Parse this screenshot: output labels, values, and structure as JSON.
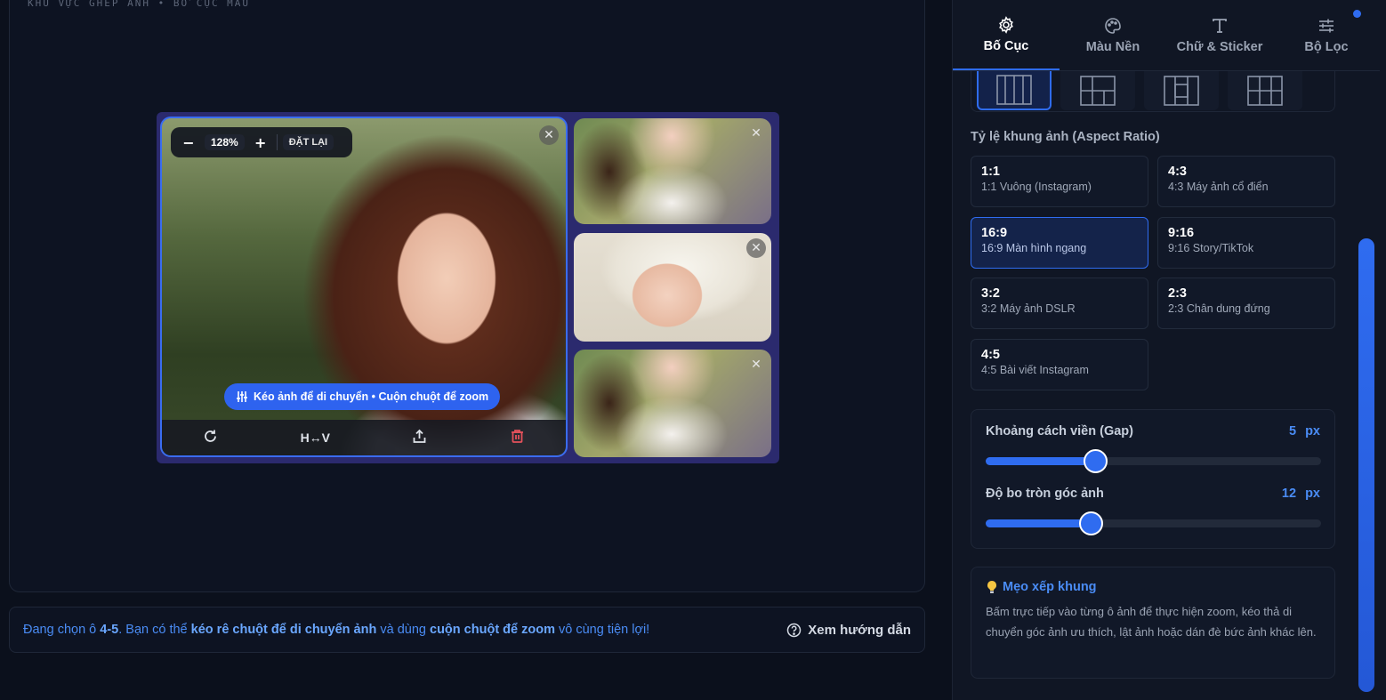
{
  "workspace": {
    "caption": "Khu vực ghép ảnh • Bố cục mẫu",
    "zoom": {
      "minus": "−",
      "value": "128%",
      "plus": "+",
      "reset": "ĐẶT LẠI"
    },
    "hint": "Kéo ảnh để di chuyển • Cuộn chuột để zoom",
    "toolbar": {
      "flip": "H↔V"
    },
    "close_glyph": "✕"
  },
  "status": {
    "prefix": "Đang chọn ô ",
    "cell": "4-5",
    "mid1": ". Bạn có thể ",
    "drag": "kéo rê chuột để di chuyển ảnh",
    "mid2": " và dùng ",
    "scroll": "cuộn chuột để zoom",
    "suffix": " vô cùng tiện lợi!",
    "guide": "Xem hướng dẫn"
  },
  "panel": {
    "tabs": [
      {
        "label": "Bố Cục",
        "icon": "gear-icon",
        "active": true
      },
      {
        "label": "Màu Nền",
        "icon": "palette-icon"
      },
      {
        "label": "Chữ & Sticker",
        "icon": "text-icon"
      },
      {
        "label": "Bộ Lọc",
        "icon": "sliders-icon"
      }
    ],
    "aspect_title": "Tỷ lệ khung ảnh (Aspect Ratio)",
    "ratios": [
      {
        "value": "1:1",
        "desc": "1:1 Vuông (Instagram)"
      },
      {
        "value": "4:3",
        "desc": "4:3 Máy ảnh cổ điển"
      },
      {
        "value": "16:9",
        "desc": "16:9 Màn hình ngang",
        "active": true
      },
      {
        "value": "9:16",
        "desc": "9:16 Story/TikTok"
      },
      {
        "value": "3:2",
        "desc": "3:2 Máy ảnh DSLR"
      },
      {
        "value": "2:3",
        "desc": "2:3 Chân dung đứng"
      },
      {
        "value": "4:5",
        "desc": "4:5 Bài viết Instagram"
      }
    ],
    "gap": {
      "label": "Khoảng cách viền (Gap)",
      "value": "5 px",
      "fraction": 0.326
    },
    "radius": {
      "label": "Độ bo tròn góc ảnh",
      "value": "12 px",
      "fraction": 0.314
    },
    "tips": {
      "title": "Mẹo xếp khung",
      "body": "Bấm trực tiếp vào từng ô ảnh để thực hiện zoom, kéo thả di chuyển góc ảnh ưu thích, lật ảnh hoặc dán đè bức ảnh khác lên."
    }
  },
  "colors": {
    "accent": "#2f6cf0",
    "danger": "#e4515b",
    "background": "#0b101c"
  }
}
